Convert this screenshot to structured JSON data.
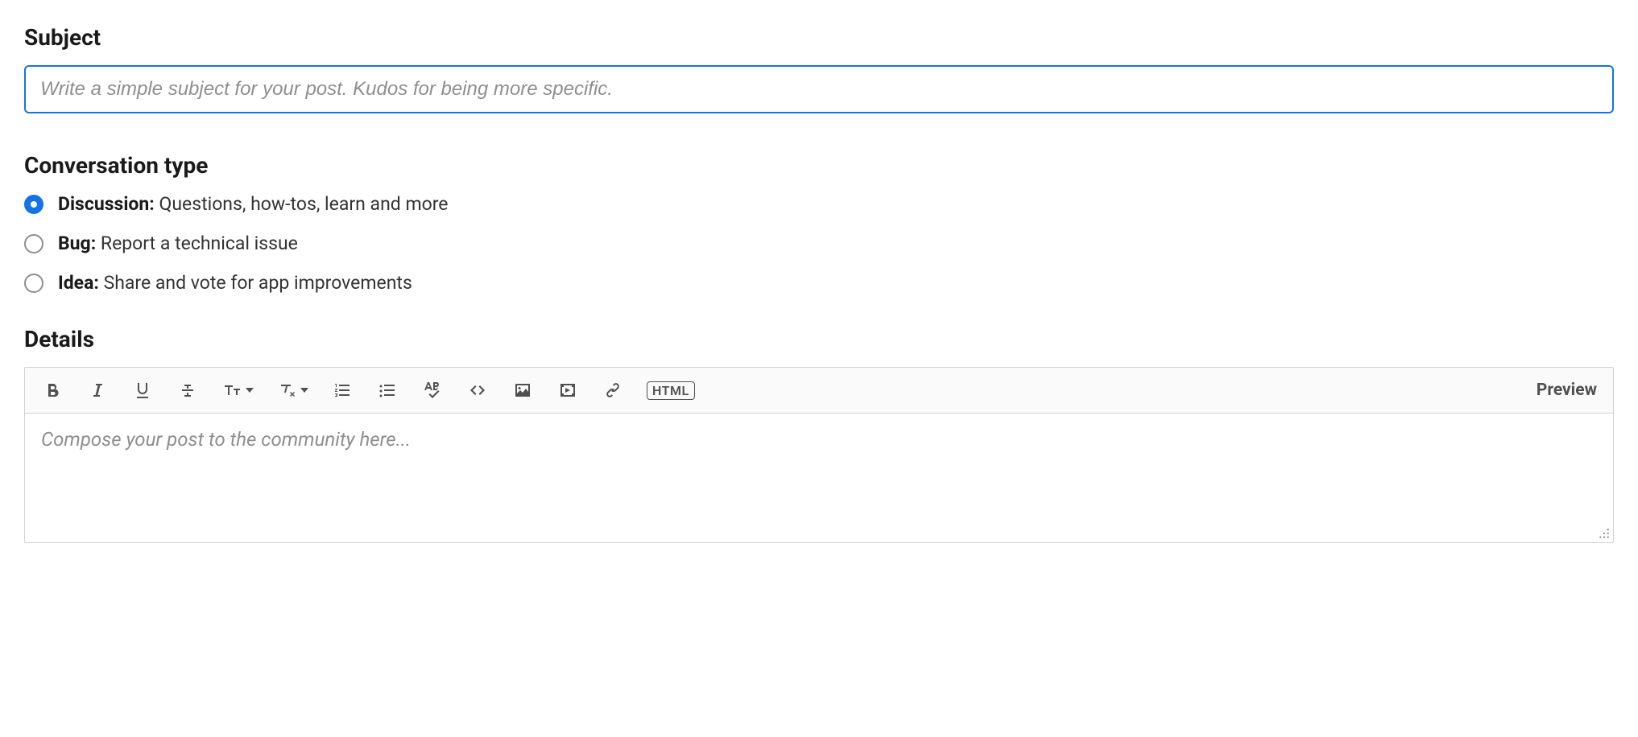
{
  "subject": {
    "label": "Subject",
    "placeholder": "Write a simple subject for your post. Kudos for being more specific.",
    "value": ""
  },
  "conversationType": {
    "label": "Conversation type",
    "options": [
      {
        "name": "Discussion:",
        "description": " Questions, how-tos, learn and more",
        "selected": true
      },
      {
        "name": "Bug:",
        "description": " Report a technical issue",
        "selected": false
      },
      {
        "name": "Idea:",
        "description": " Share and vote for app improvements",
        "selected": false
      }
    ]
  },
  "details": {
    "label": "Details",
    "placeholder": "Compose your post to the community here...",
    "toolbar": {
      "htmlLabel": "HTML",
      "previewLabel": "Preview"
    }
  }
}
